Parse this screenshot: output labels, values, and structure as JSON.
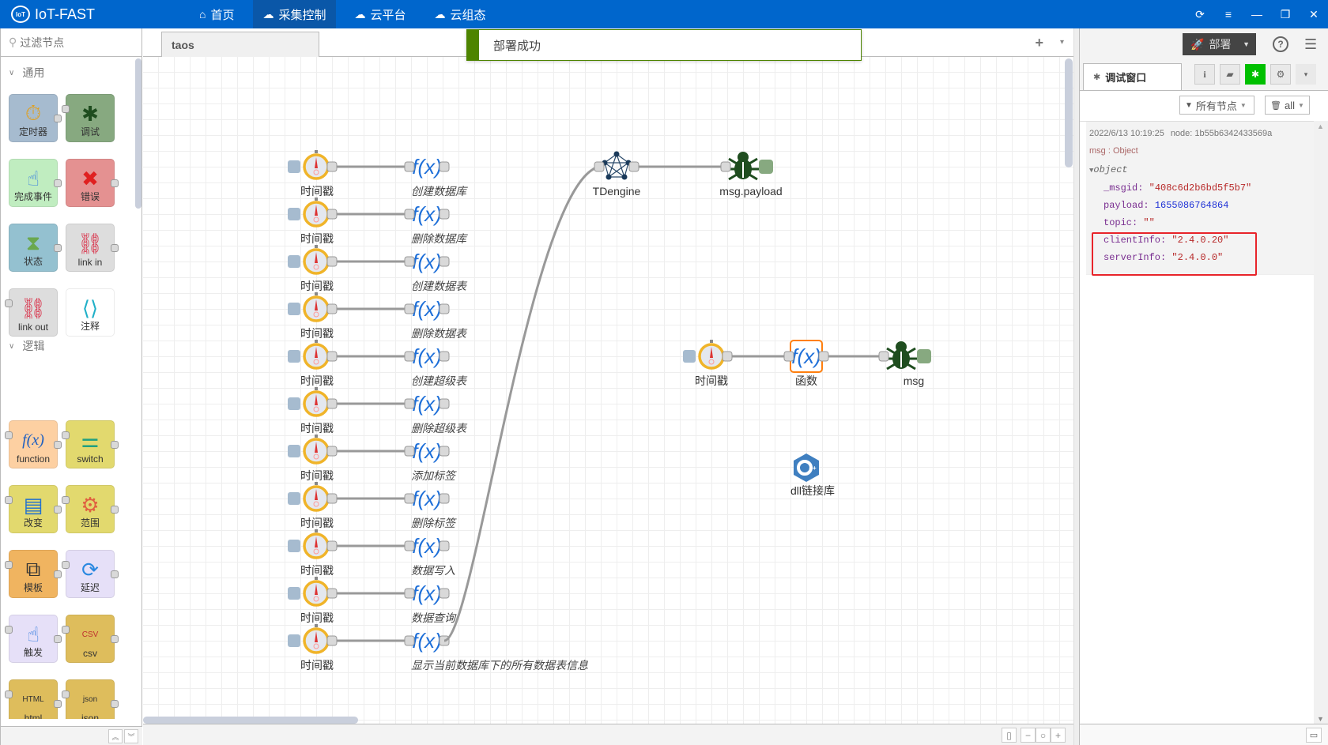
{
  "app": {
    "title": "IoT-FAST",
    "logo_text": "IoT"
  },
  "nav": [
    {
      "label": "首页",
      "icon": "home-icon",
      "glyph": "⌂"
    },
    {
      "label": "采集控制",
      "icon": "cloud-settings-icon",
      "glyph": "☁",
      "active": true
    },
    {
      "label": "云平台",
      "icon": "cloud-platform-icon",
      "glyph": "☁"
    },
    {
      "label": "云组态",
      "icon": "cloud-config-icon",
      "glyph": "☁"
    }
  ],
  "window_controls": {
    "refresh": "⟳",
    "menu": "≡",
    "minimize": "—",
    "maximize": "❐",
    "close": "✕"
  },
  "palette": {
    "search_placeholder": "过滤节点",
    "categories": [
      {
        "label": "通用",
        "nodes": [
          {
            "label": "定时器",
            "color": "#a6bbcf"
          },
          {
            "label": "调试",
            "color": "#87a980"
          },
          {
            "label": "完成事件",
            "color": "#c0edc0"
          },
          {
            "label": "错误",
            "color": "#e49191"
          },
          {
            "label": "状态",
            "color": "#94c1d0"
          },
          {
            "label": "link in",
            "color": "#dddddd"
          },
          {
            "label": "link out",
            "color": "#dddddd"
          },
          {
            "label": "注释",
            "color": "#ffffff"
          }
        ]
      },
      {
        "label": "逻辑",
        "nodes": [
          {
            "label": "function",
            "color": "#fdd0a2"
          },
          {
            "label": "switch",
            "color": "#e2d96e"
          },
          {
            "label": "改变",
            "color": "#e2d96e"
          },
          {
            "label": "范围",
            "color": "#e2d96e"
          },
          {
            "label": "模板",
            "color": "#f0b460"
          },
          {
            "label": "延迟",
            "color": "#e6e0f8"
          },
          {
            "label": "触发",
            "color": "#e6e0f8"
          },
          {
            "label": "csv",
            "color": "#debd5c"
          },
          {
            "label": "html",
            "color": "#debd5c"
          },
          {
            "label": "json",
            "color": "#debd5c"
          }
        ]
      }
    ],
    "scroll_up": "︽",
    "scroll_down": "︾"
  },
  "workspace": {
    "tab": "taos",
    "add_label": "+",
    "menu_label": "▾",
    "notification": "部署成功",
    "flows": {
      "timer_label": "时间戳",
      "functions": [
        "创建数据库",
        "删除数据库",
        "创建数据表",
        "删除数据表",
        "创建超级表",
        "删除超级表",
        "添加标签",
        "删除标签",
        "数据写入",
        "数据查询",
        "显示当前数据库下的所有数据表信息"
      ],
      "tdengine_label": "TDengine",
      "debug1_label": "msg.payload",
      "timer2_label": "时间戳",
      "function2_label": "函数",
      "debug2_label": "msg",
      "dll_label": "dll链接库"
    }
  },
  "sidebar": {
    "deploy_label": "部署",
    "help": "?",
    "tab_label": "调试窗口",
    "tab_buttons": [
      "i",
      "book",
      "bug",
      "gear",
      "▾"
    ],
    "filter_label": "所有节点",
    "clear_label": "all",
    "debug_messages": [
      {
        "timestamp": "2022/6/13 10:19:25",
        "node": "node: 1b55b6342433569a",
        "topic_line": "msg : Object",
        "object_label": "object",
        "props": [
          {
            "key": "_msgid",
            "value": "\"408c6d2b6bd5f5b7\"",
            "type": "string"
          },
          {
            "key": "payload",
            "value": "1655086764864",
            "type": "number"
          },
          {
            "key": "topic",
            "value": "\"\"",
            "type": "string"
          },
          {
            "key": "clientInfo",
            "value": "\"2.4.0.20\"",
            "type": "string"
          },
          {
            "key": "serverInfo",
            "value": "\"2.4.0.0\"",
            "type": "string"
          }
        ]
      }
    ]
  }
}
